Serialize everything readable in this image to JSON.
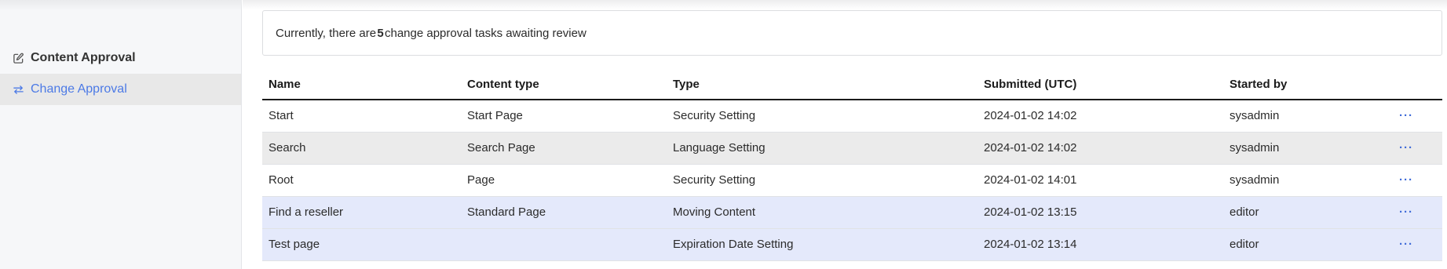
{
  "sidebar": {
    "items": [
      {
        "label": "Content Approval",
        "icon": "edit-icon",
        "active": false
      },
      {
        "label": "Change Approval",
        "icon": "sync-arrows-icon",
        "active": true
      }
    ]
  },
  "notice": {
    "prefix": "Currently, there are ",
    "count": "5",
    "suffix": " change approval tasks awaiting review"
  },
  "table": {
    "headers": [
      "Name",
      "Content type",
      "Type",
      "Submitted (UTC)",
      "Started by"
    ],
    "rows": [
      {
        "name": "Start",
        "content_type": "Start Page",
        "type": "Security Setting",
        "submitted": "2024-01-02 14:02",
        "started_by": "sysadmin",
        "actions": "···"
      },
      {
        "name": "Search",
        "content_type": "Search Page",
        "type": "Language Setting",
        "submitted": "2024-01-02 14:02",
        "started_by": "sysadmin",
        "actions": "···"
      },
      {
        "name": "Root",
        "content_type": "Page",
        "type": "Security Setting",
        "submitted": "2024-01-02 14:01",
        "started_by": "sysadmin",
        "actions": "···"
      },
      {
        "name": "Find a reseller",
        "content_type": "Standard Page",
        "type": "Moving Content",
        "submitted": "2024-01-02 13:15",
        "started_by": "editor",
        "actions": "···"
      },
      {
        "name": "Test page",
        "content_type": "",
        "type": "Expiration Date Setting",
        "submitted": "2024-01-02 13:14",
        "started_by": "editor",
        "actions": "···"
      }
    ]
  },
  "colors": {
    "accent": "#4c7ae6",
    "row_hover": "#ebebeb",
    "row_selected": "#e4e9fb",
    "sidebar_bg": "#f6f7f9"
  }
}
